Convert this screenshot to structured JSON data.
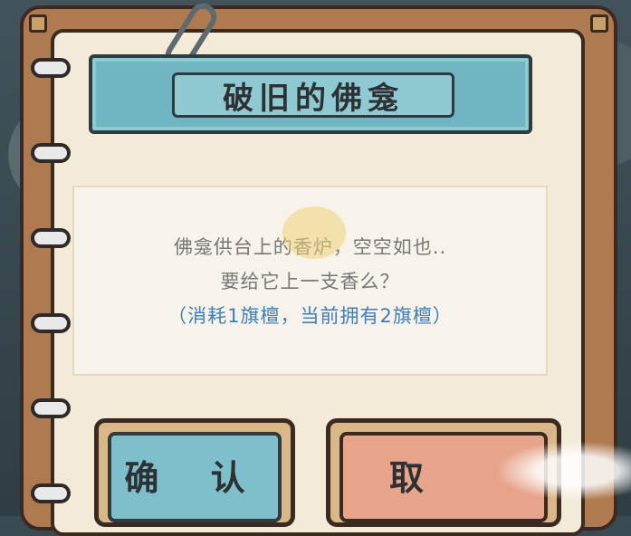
{
  "dialog": {
    "title": "破旧的佛龛",
    "message_line1": "佛龛供台上的香炉，空空如也..",
    "message_line2": "要给它上一支香么？",
    "cost_line": "（消耗1旗檀，当前拥有2旗檀）"
  },
  "buttons": {
    "confirm_label": "确 认",
    "cancel_label": "取"
  },
  "colors": {
    "banner": "#6fb5c2",
    "confirm": "#7fbfcb",
    "cancel": "#e8a48b",
    "cost_text": "#3f7fb8",
    "page": "#f4ead8"
  }
}
